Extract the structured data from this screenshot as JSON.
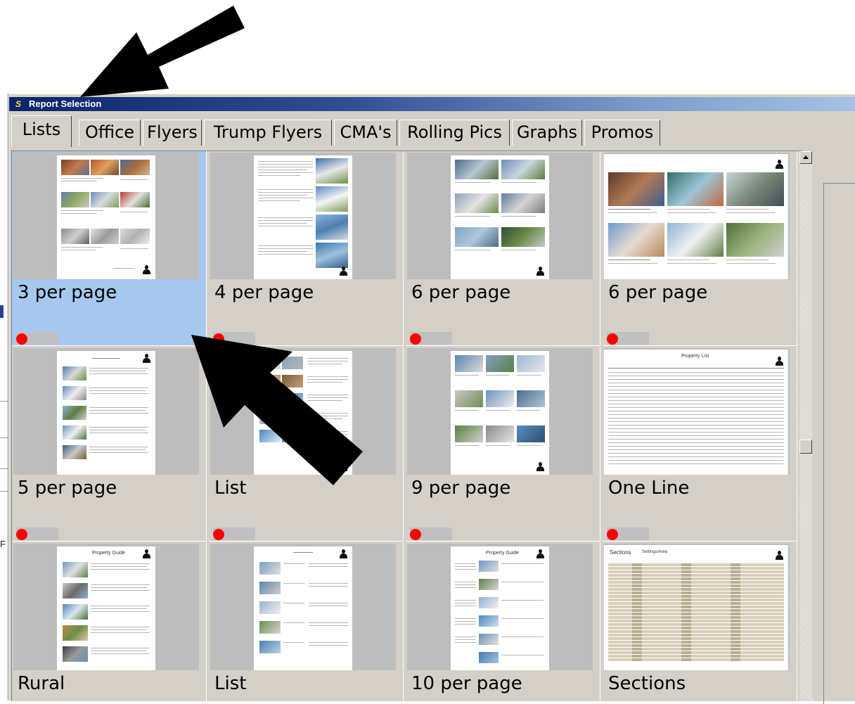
{
  "window": {
    "title": "Report Selection",
    "app_icon": "S"
  },
  "tabs": [
    {
      "label": "Lists",
      "active": true
    },
    {
      "label": "Office"
    },
    {
      "label": "Flyers"
    },
    {
      "label": "Trump Flyers"
    },
    {
      "label": "CMA's"
    },
    {
      "label": "Rolling Pics"
    },
    {
      "label": "Graphs"
    },
    {
      "label": "Promos"
    }
  ],
  "reports": [
    {
      "label": "3 per page",
      "selected": true
    },
    {
      "label": "4 per page"
    },
    {
      "label": "6 per page"
    },
    {
      "label": "6 per page"
    },
    {
      "label": "5 per page"
    },
    {
      "label": "List"
    },
    {
      "label": "9 per page"
    },
    {
      "label": "One Line"
    },
    {
      "label": "Rural"
    },
    {
      "label": "List"
    },
    {
      "label": "10 per page"
    },
    {
      "label": "Sections"
    }
  ],
  "thumb_text": {
    "property_list": "Property List",
    "property_guide": "Property Guide",
    "sections_tab1": "Sections",
    "sections_tab2": "Settings/Area"
  },
  "left_edge_char": "F",
  "colors": {
    "selection": "#a6c8ee",
    "status_dot": "#ff0000",
    "titlebar": "#0a246a"
  }
}
